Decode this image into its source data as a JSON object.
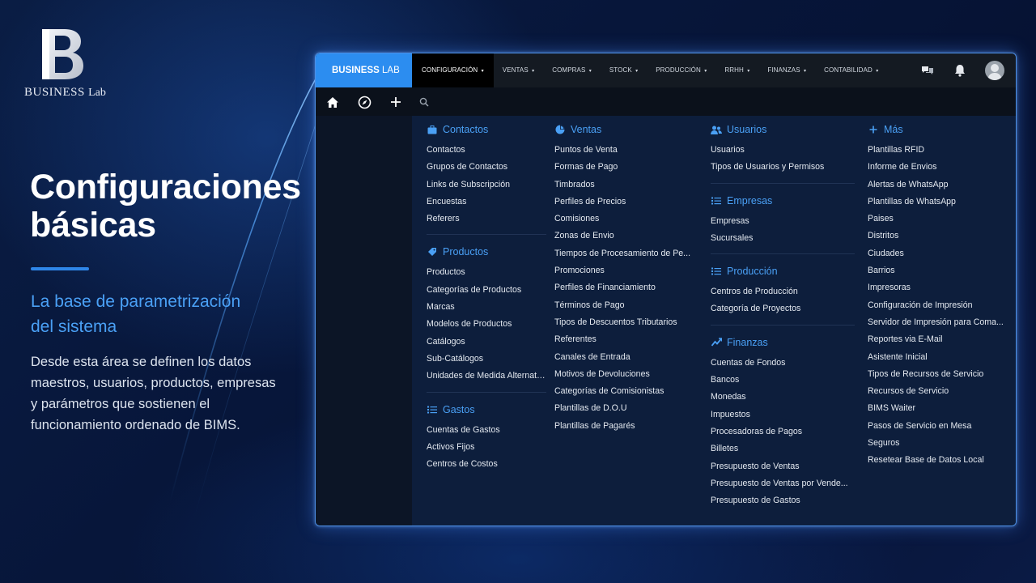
{
  "brand_logo": {
    "word": "BUSINESS",
    "sub": "Lab"
  },
  "hero": {
    "title_line1": "Configuraciones",
    "title_line2": "básicas",
    "subtitle_line1": "La base de parametrización",
    "subtitle_line2": "del sistema",
    "body_line1": "Desde esta área se definen los datos",
    "body_line2": "maestros, usuarios, productos, empresas",
    "body_line3": "y parámetros que sostienen el",
    "body_line4": "funcionamiento ordenado de BIMS."
  },
  "app": {
    "brand": {
      "word": "BUSINESS",
      "sub": "LAB"
    },
    "nav": [
      {
        "label": "CONFIGURACIÓN",
        "caret": "▾"
      },
      {
        "label": "VENTAS",
        "caret": "▾"
      },
      {
        "label": "COMPRAS",
        "caret": "▾"
      },
      {
        "label": "STOCK",
        "caret": "▾"
      },
      {
        "label": "PRODUCCIÓN",
        "caret": "▾"
      },
      {
        "label": "RRHH",
        "caret": "▾"
      },
      {
        "label": "FINANZAS",
        "caret": "▾"
      },
      {
        "label": "CONTABILIDAD",
        "caret": "▾"
      }
    ],
    "top_icons": [
      "chat-icon",
      "bell-icon",
      "user-avatar"
    ],
    "toolbar_icons": [
      "home-icon",
      "compass-icon",
      "plus-icon",
      "search-icon"
    ]
  },
  "menu": {
    "col1": {
      "contactos": {
        "title": "Contactos",
        "icon": "briefcase-icon",
        "items": [
          "Contactos",
          "Grupos de Contactos",
          "Links de Subscripción",
          "Encuestas",
          "Referers"
        ]
      },
      "productos": {
        "title": "Productos",
        "icon": "tag-icon",
        "items": [
          "Productos",
          "Categorías de Productos",
          "Marcas",
          "Modelos de Productos",
          "Catálogos",
          "Sub-Catálogos",
          "Unidades de Medida Alternativas"
        ]
      },
      "gastos": {
        "title": "Gastos",
        "icon": "list-icon",
        "items": [
          "Cuentas de Gastos",
          "Activos Fijos",
          "Centros de Costos"
        ]
      }
    },
    "col2": {
      "ventas": {
        "title": "Ventas",
        "icon": "pie-chart-icon",
        "items": [
          "Puntos de Venta",
          "Formas de Pago",
          "Timbrados",
          "Perfiles de Precios",
          "Comisiones",
          "Zonas de Envio",
          "Tiempos de Procesamiento de Pe...",
          "Promociones",
          "Perfiles de Financiamiento",
          "Términos de Pago",
          "Tipos de Descuentos Tributarios",
          "Referentes",
          "Canales de Entrada",
          "Motivos de Devoluciones",
          "Categorías de Comisionistas",
          "Plantillas de D.O.U",
          "Plantillas de Pagarés"
        ]
      }
    },
    "col3": {
      "usuarios": {
        "title": "Usuarios",
        "icon": "users-icon",
        "items": [
          "Usuarios",
          "Tipos de Usuarios y Permisos"
        ]
      },
      "empresas": {
        "title": "Empresas",
        "icon": "list-icon",
        "items": [
          "Empresas",
          "Sucursales"
        ]
      },
      "produccion": {
        "title": "Producción",
        "icon": "list-icon",
        "items": [
          "Centros de Producción",
          "Categoría de Proyectos"
        ]
      },
      "finanzas": {
        "title": "Finanzas",
        "icon": "trend-icon",
        "items": [
          "Cuentas de Fondos",
          "Bancos",
          "Monedas",
          "Impuestos",
          "Procesadoras de Pagos",
          "Billetes",
          "Presupuesto de Ventas",
          "Presupuesto de Ventas por Vende...",
          "Presupuesto de Gastos"
        ]
      }
    },
    "col4": {
      "mas": {
        "title": "Más",
        "icon": "plus-icon",
        "items": [
          "Plantillas RFID",
          "Informe de Envios",
          "Alertas de WhatsApp",
          "Plantillas de WhatsApp",
          "Paises",
          "Distritos",
          "Ciudades",
          "Barrios",
          "Impresoras",
          "Configuración de Impresión",
          "Servidor de Impresión para Coma...",
          "Reportes via E-Mail",
          "Asistente Inicial",
          "Tipos de Recursos de Servicio",
          "Recursos de Servicio",
          "BIMS Waiter",
          "Pasos de Servicio en Mesa",
          "Seguros",
          "Resetear Base de Datos Local"
        ]
      }
    }
  },
  "colors": {
    "accent": "#2c8df0",
    "section_title": "#4aa0f5",
    "window_border": "#4d8fe6"
  }
}
